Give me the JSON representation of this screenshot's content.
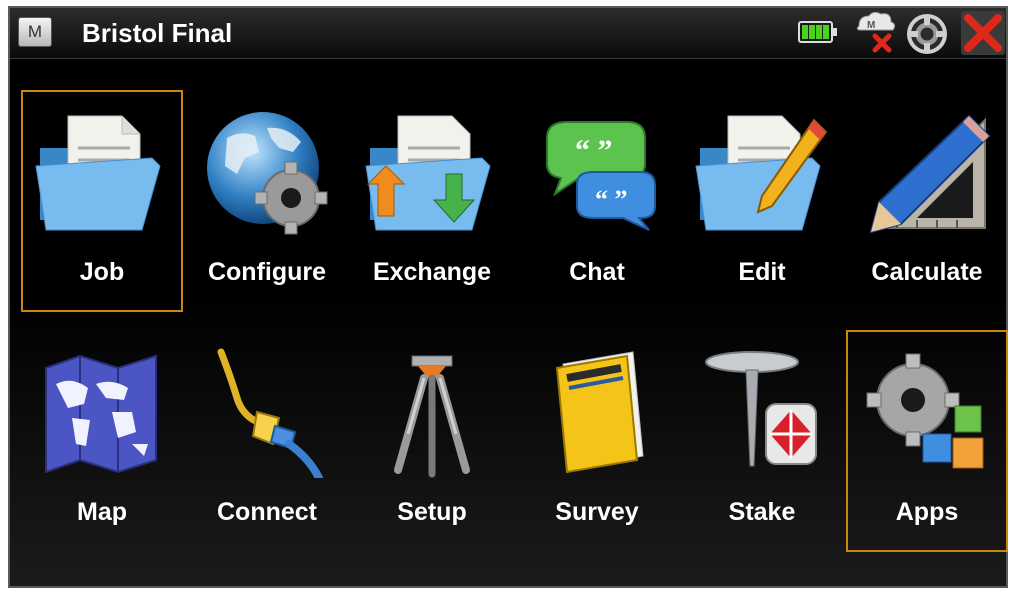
{
  "titlebar": {
    "menu_glyph": "M",
    "title": "Bristol Final",
    "status_icons": [
      "battery-icon",
      "instrument-disconnected-icon",
      "sync-icon",
      "close-icon"
    ],
    "battery_level": 1.0
  },
  "colors": {
    "selection_border": "#c9870c",
    "battery": "#48d11e",
    "close": "#e0281a"
  },
  "apps": [
    {
      "label": "Job",
      "icon": "job-folder-icon",
      "selected": true
    },
    {
      "label": "Configure",
      "icon": "globe-gear-icon",
      "selected": false
    },
    {
      "label": "Exchange",
      "icon": "exchange-folder-icon",
      "selected": false
    },
    {
      "label": "Chat",
      "icon": "chat-bubbles-icon",
      "selected": false
    },
    {
      "label": "Edit",
      "icon": "edit-folder-pencil-icon",
      "selected": false
    },
    {
      "label": "Calculate",
      "icon": "pencil-ruler-icon",
      "selected": false
    },
    {
      "label": "Map",
      "icon": "map-icon",
      "selected": false
    },
    {
      "label": "Connect",
      "icon": "cable-icon",
      "selected": false
    },
    {
      "label": "Setup",
      "icon": "tripod-icon",
      "selected": false
    },
    {
      "label": "Survey",
      "icon": "survey-notebook-icon",
      "selected": false
    },
    {
      "label": "Stake",
      "icon": "survey-stake-icon",
      "selected": false
    },
    {
      "label": "Apps",
      "icon": "apps-gear-blocks-icon",
      "selected": true
    }
  ]
}
